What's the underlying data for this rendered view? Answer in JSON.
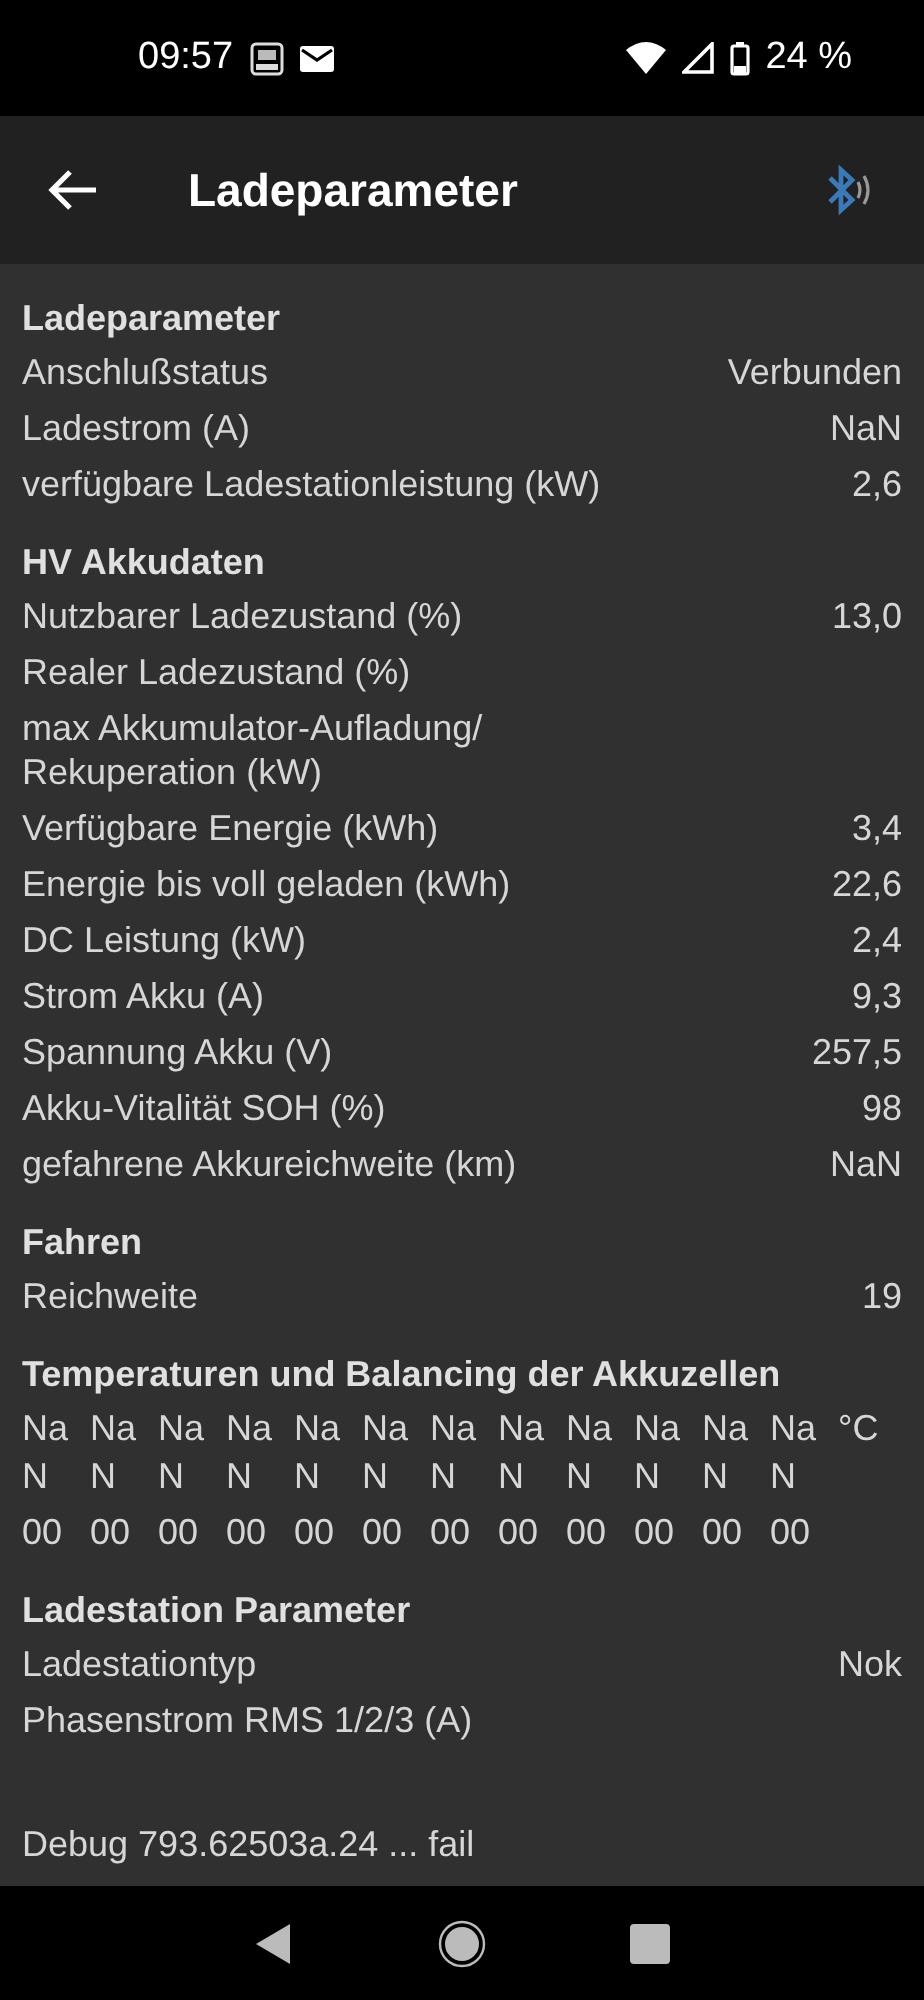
{
  "status_bar": {
    "time": "09:57",
    "battery": "24 %"
  },
  "app_bar": {
    "title": "Ladeparameter"
  },
  "sections": [
    {
      "title": "Ladeparameter",
      "rows": [
        {
          "label": "Anschlußstatus",
          "value": "Verbunden"
        },
        {
          "label": "Ladestrom (A)",
          "value": "NaN"
        },
        {
          "label": "verfügbare Ladestationleistung (kW)",
          "value": "2,6"
        }
      ]
    },
    {
      "title": "HV Akkudaten",
      "rows": [
        {
          "label": "Nutzbarer Ladezustand (%)",
          "value": "13,0"
        },
        {
          "label": "Realer Ladezustand (%)"
        },
        {
          "label": "max Akkumulator-Aufladung/ Rekuperation (kW)"
        },
        {
          "label": "Verfügbare Energie (kWh)",
          "value": "3,4"
        },
        {
          "label": "Energie bis voll geladen (kWh)",
          "value": "22,6"
        },
        {
          "label": "DC Leistung (kW)",
          "value": "2,4"
        },
        {
          "label": "Strom Akku (A)",
          "value": "9,3"
        },
        {
          "label": "Spannung Akku (V)",
          "value": "257,5"
        },
        {
          "label": "Akku-Vitalität SOH (%)",
          "value": "98"
        },
        {
          "label": "gefahrene Akkureichweite (km)",
          "value": "NaN"
        }
      ]
    },
    {
      "title": "Fahren",
      "rows": [
        {
          "label": "Reichweite",
          "value": "19"
        }
      ]
    },
    {
      "title": "Temperaturen und Balancing der Akkuzellen",
      "cells": {
        "temperatures": [
          "NaN",
          "NaN",
          "NaN",
          "NaN",
          "NaN",
          "NaN",
          "NaN",
          "NaN",
          "NaN",
          "NaN",
          "NaN",
          "NaN"
        ],
        "unit": "°C",
        "balancing": [
          "00",
          "00",
          "00",
          "00",
          "00",
          "00",
          "00",
          "00",
          "00",
          "00",
          "00",
          "00"
        ]
      }
    },
    {
      "title": "Ladestation Parameter",
      "rows": [
        {
          "label": "Ladestationtyp",
          "value": "Nok"
        },
        {
          "label": "Phasenstrom RMS 1/2/3 (A)"
        }
      ]
    }
  ],
  "debug": "Debug 793.62503a.24 ... fail"
}
